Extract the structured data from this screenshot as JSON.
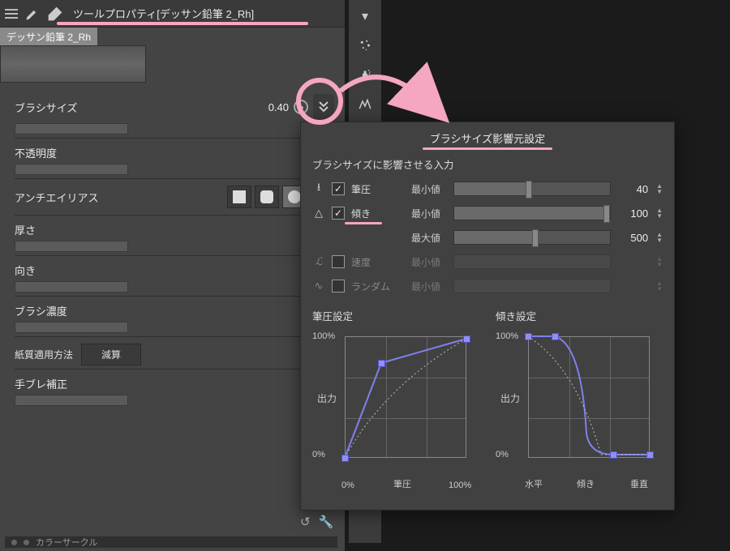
{
  "panel": {
    "title": "ツールプロパティ[デッサン鉛筆 2_Rh]",
    "brush_name": "デッサン鉛筆 2_Rh"
  },
  "props": {
    "brush_size_label": "ブラシサイズ",
    "brush_size_value": "0.40",
    "opacity_label": "不透明度",
    "aa_label": "アンチエイリアス",
    "thickness_label": "厚さ",
    "direction_label": "向き",
    "density_label": "ブラシ濃度",
    "paper_method_label": "紙質適用方法",
    "paper_method_value": "減算",
    "stabilization_label": "手ブレ補正"
  },
  "popup": {
    "title": "ブラシサイズ影響元設定",
    "subtitle": "ブラシサイズに影響させる入力",
    "pressure": {
      "label": "筆圧",
      "min_label": "最小値",
      "min_val": "40"
    },
    "tilt": {
      "label": "傾き",
      "min_label": "最小値",
      "min_val": "100",
      "max_label": "最大値",
      "max_val": "500"
    },
    "speed": {
      "label": "速度",
      "min_label": "最小値"
    },
    "random": {
      "label": "ランダム",
      "min_label": "最小値"
    },
    "graph_pressure_title": "筆圧設定",
    "graph_tilt_title": "傾き設定",
    "y100": "100%",
    "y0": "0%",
    "out_label": "出力",
    "press_x0": "0%",
    "press_xmid": "筆圧",
    "press_x100": "100%",
    "tilt_x0": "水平",
    "tilt_xmid": "傾き",
    "tilt_x2": "垂直"
  },
  "bottom_label": "カラーサークル",
  "chart_data": [
    {
      "type": "line",
      "title": "筆圧設定",
      "xlabel": "筆圧",
      "ylabel": "出力",
      "xlim": [
        0,
        100
      ],
      "ylim": [
        0,
        100
      ],
      "series": [
        {
          "name": "curve",
          "x": [
            0,
            30,
            100
          ],
          "y": [
            0,
            78,
            98
          ]
        }
      ],
      "grid": true
    },
    {
      "type": "line",
      "title": "傾き設定",
      "xlabel": "傾き",
      "ylabel": "出力",
      "x_ticks": [
        "水平",
        "傾き",
        "垂直"
      ],
      "ylim": [
        0,
        100
      ],
      "series": [
        {
          "name": "curve",
          "x": [
            0,
            22,
            48,
            70,
            100
          ],
          "y": [
            100,
            100,
            20,
            3,
            3
          ]
        }
      ],
      "grid": true
    }
  ]
}
